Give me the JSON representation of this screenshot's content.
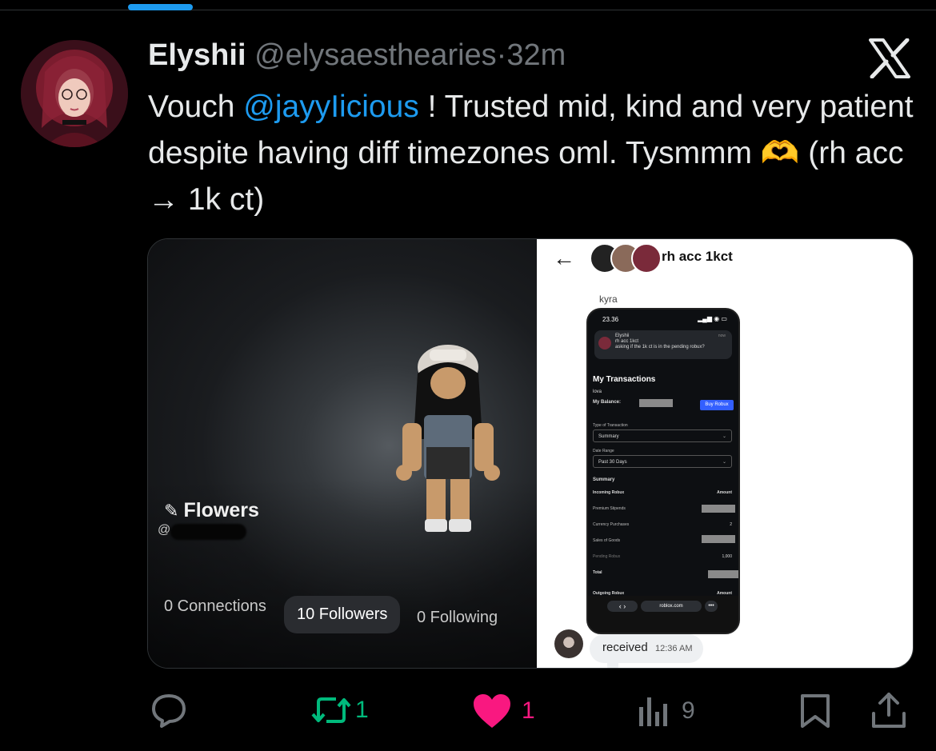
{
  "post": {
    "display_name": "Elyshii",
    "handle": "@elysaesthearies",
    "separator": "·",
    "time": "32m",
    "text_prefix": "Vouch ",
    "mention": "@jayyIicious",
    "text_suffix": " ! Trusted mid, kind and very patient despite having diff timezones oml. Tysmmm 🫶 (rh acc → 1k ct)"
  },
  "media_left": {
    "profile_name": "Flowers",
    "handle_prefix": "@",
    "stats": {
      "connections": "0 Connections",
      "followers": "10 Followers",
      "following": "0 Following"
    }
  },
  "media_right": {
    "back_icon": "arrow-left-icon",
    "chat_title": "rh acc 1kct",
    "sender_name": "kyra",
    "phone": {
      "status_time": "23.36",
      "status_icons": "▂▄▆ ◉ ▭",
      "notification": {
        "name": "Elyshii",
        "subject": "rh acc 1kct",
        "message": "asking if the 1k ct is in the pending robux?",
        "time": "now"
      },
      "heading": "My Transactions",
      "username": "lova",
      "balance_label": "My Balance:",
      "buy_button": "Buy Robux",
      "type_label": "Type of Transaction",
      "type_value": "Summary",
      "range_label": "Date Range",
      "range_value": "Past 30 Days",
      "summary_heading": "Summary",
      "incoming_header": "Incoming Robux",
      "amount_header": "Amount",
      "rows": [
        {
          "label": "Premium Stipends",
          "amount": ""
        },
        {
          "label": "Currency Purchases",
          "amount": "2"
        },
        {
          "label": "Sales of Goods",
          "amount": ""
        },
        {
          "label": "Pending Robux",
          "amount": "1,000"
        },
        {
          "label": "Total",
          "amount": ""
        }
      ],
      "outgoing_header": "Outgoing Robux",
      "outgoing_amount_header": "Amount",
      "nav_buttons": "‹   ›",
      "url": "roblox.com",
      "more": "•••"
    },
    "received_message": "received",
    "received_time": "12:36 AM"
  },
  "actions": {
    "reply_count": "",
    "repost_count": "1",
    "like_count": "1",
    "views_count": "9"
  },
  "colors": {
    "accent": "#1d9bf0",
    "repost": "#00ba7c",
    "like": "#f91880",
    "muted": "#71767b"
  }
}
